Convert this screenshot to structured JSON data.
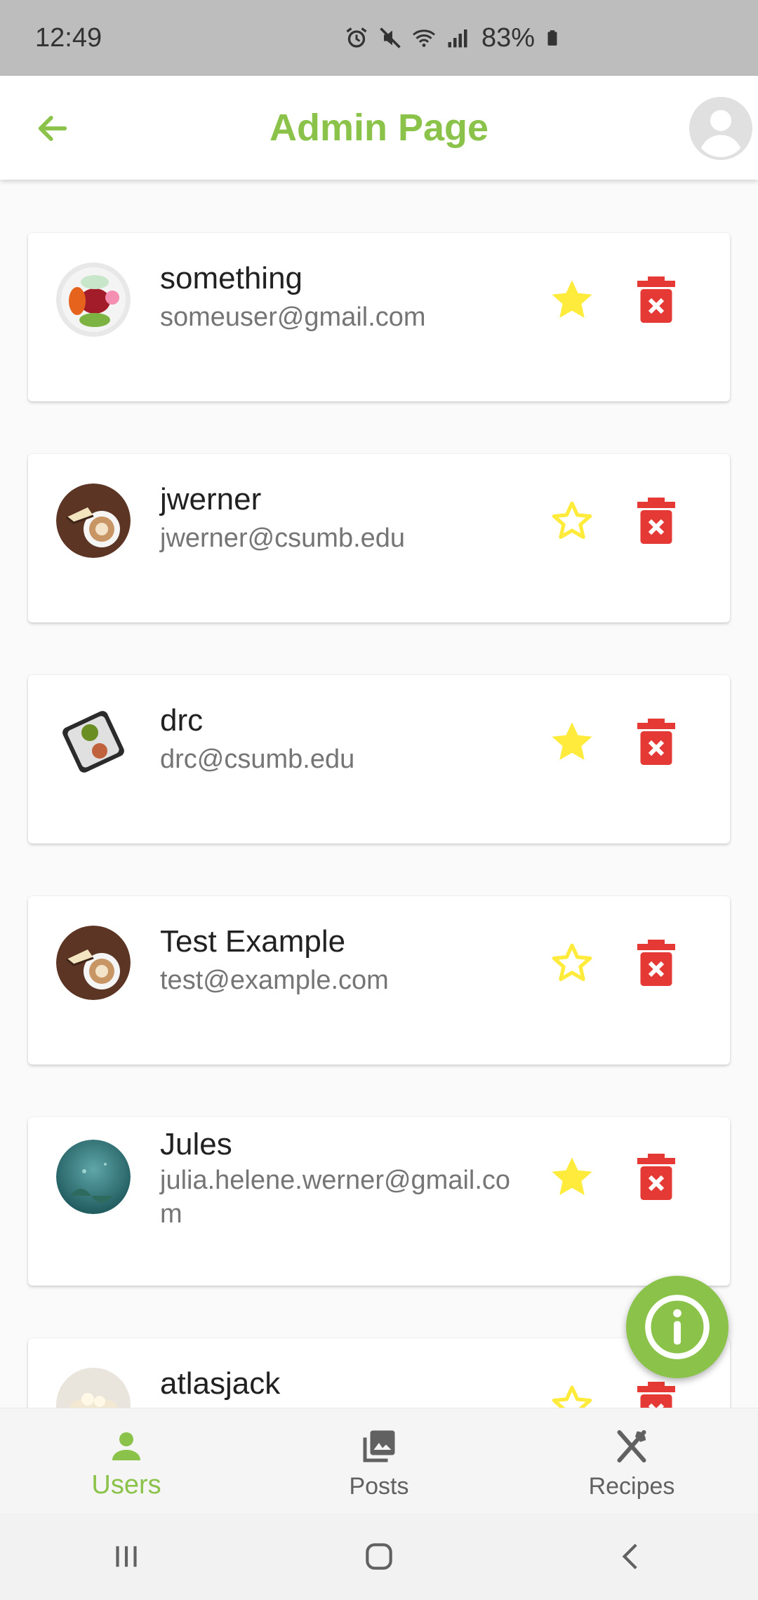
{
  "status_bar": {
    "time": "12:49",
    "battery": "83%",
    "icons": [
      "alarm-icon",
      "mute-icon",
      "wifi-icon",
      "signal-icon",
      "battery-icon"
    ]
  },
  "app_bar": {
    "title": "Admin Page",
    "back_icon": "arrow-back-icon",
    "avatar_icon": "account-circle-icon"
  },
  "colors": {
    "accent": "#8bc34a",
    "star": "#ffeb3b",
    "delete": "#e53935"
  },
  "users": [
    {
      "name": "something",
      "email": "someuser@gmail.com",
      "starred": true,
      "avatar": "salad-bowl-photo"
    },
    {
      "name": "jwerner",
      "email": "jwerner@csumb.edu",
      "starred": false,
      "avatar": "cake-and-coffee-photo"
    },
    {
      "name": "drc",
      "email": "drc@csumb.edu",
      "starred": true,
      "avatar": "meal-tray-photo"
    },
    {
      "name": "Test Example",
      "email": "test@example.com",
      "starred": false,
      "avatar": "cake-and-coffee-photo"
    },
    {
      "name": "Jules",
      "email": "julia.helene.werner@gmail.com",
      "starred": true,
      "avatar": "aquarium-photo"
    },
    {
      "name": "atlasjack",
      "email": "",
      "starred": false,
      "avatar": "cake-photo"
    }
  ],
  "fab": {
    "icon": "info-icon"
  },
  "bottom_nav": {
    "items": [
      {
        "label": "Users",
        "icon": "person-icon",
        "active": true
      },
      {
        "label": "Posts",
        "icon": "photo-icon",
        "active": false
      },
      {
        "label": "Recipes",
        "icon": "utensils-icon",
        "active": false
      }
    ]
  },
  "system_nav": [
    "recents-icon",
    "home-icon",
    "back-icon"
  ]
}
